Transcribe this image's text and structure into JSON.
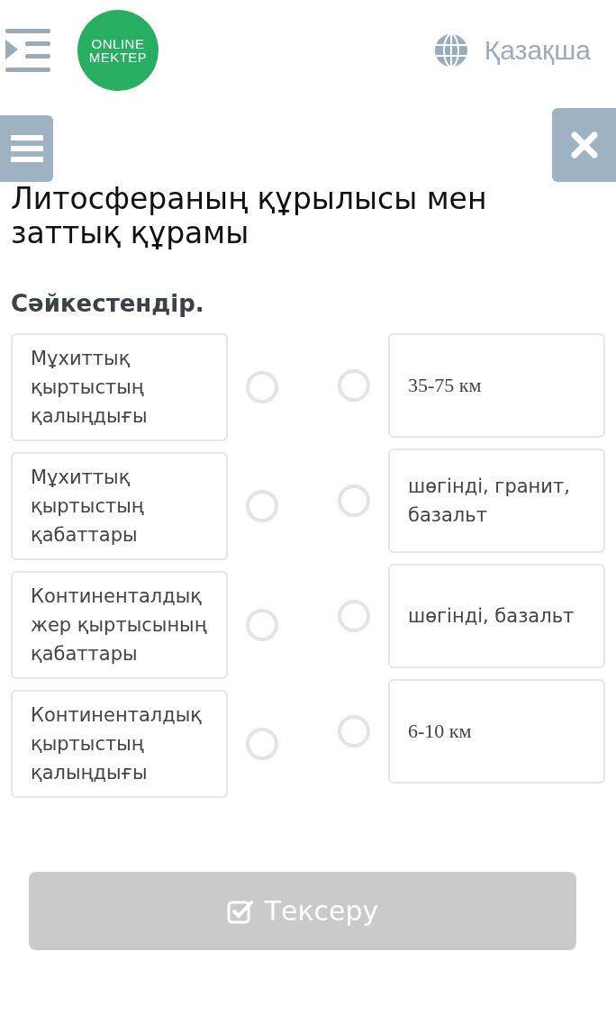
{
  "header": {
    "logo": [
      "ONLINE",
      "MEKTEP"
    ],
    "language": "Қазақша"
  },
  "title": "Литосфераның құрылысы мен заттық құрамы",
  "instruction": "Сәйкестендір.",
  "left_items": [
    {
      "text": "Мұхиттық қыртыстың қалыңдығы",
      "kind": "sans",
      "selected": false
    },
    {
      "text": "Мұхиттық қыртыстың қабаттары",
      "kind": "sans",
      "selected": false
    },
    {
      "text": "Континенталдық жер қыртысының қабаттары",
      "kind": "sans",
      "selected": false
    },
    {
      "text": "Континенталдық қыртыстың қалыңдығы",
      "kind": "sans",
      "selected": false
    }
  ],
  "right_items": [
    {
      "text": "35-75 км",
      "kind": "serif",
      "selected": false
    },
    {
      "text": "шөгінді, гранит, базальт",
      "kind": "sans",
      "selected": false
    },
    {
      "text": "шөгінді, базальт",
      "kind": "sans",
      "selected": false
    },
    {
      "text": "6-10 км",
      "kind": "serif",
      "selected": false
    }
  ],
  "check_button": {
    "label": "Тексеру",
    "disabled": true
  }
}
